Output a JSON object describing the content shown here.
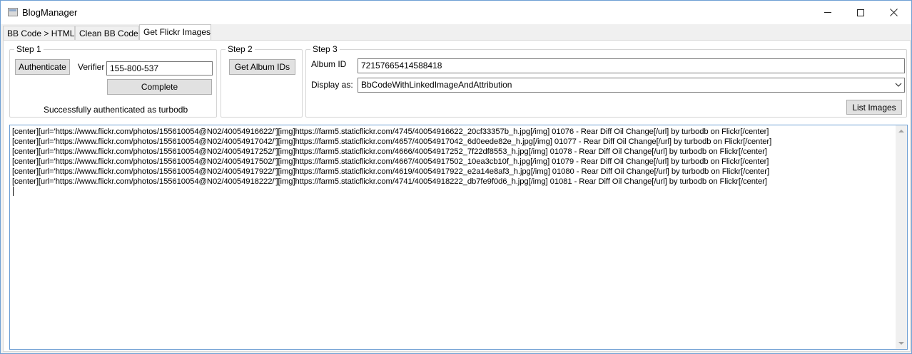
{
  "window": {
    "title": "BlogManager",
    "border_color": "#6e9fd4"
  },
  "title_controls": {
    "minimize_icon": "minimize-icon",
    "maximize_icon": "maximize-icon",
    "close_icon": "close-icon"
  },
  "tabs": [
    {
      "label": "BB Code > HTML",
      "active": false
    },
    {
      "label": "Clean BB Code",
      "active": false
    },
    {
      "label": "Get Flickr Images",
      "active": true
    }
  ],
  "step1": {
    "label": "Step 1",
    "authenticate_label": "Authenticate",
    "verifier_label": "Verifier",
    "verifier_value": "155-800-537",
    "complete_label": "Complete",
    "status_text": "Successfully authenticated as turbodb"
  },
  "step2": {
    "label": "Step 2",
    "get_album_ids_label": "Get Album IDs"
  },
  "step3": {
    "label": "Step 3",
    "album_id_label": "Album ID",
    "album_id_value": "72157665414588418",
    "display_as_label": "Display as:",
    "display_as_value": "BbCodeWithLinkedImageAndAttribution",
    "list_images_label": "List Images"
  },
  "output": {
    "lines": [
      "[center][url='https://www.flickr.com/photos/155610054@N02/40054916622/'][img]https://farm5.staticflickr.com/4745/40054916622_20cf33357b_h.jpg[/img] 01076 - Rear Diff Oil Change[/url] by turbodb on Flickr[/center]",
      "[center][url='https://www.flickr.com/photos/155610054@N02/40054917042/'][img]https://farm5.staticflickr.com/4657/40054917042_6d0eede82e_h.jpg[/img] 01077 - Rear Diff Oil Change[/url] by turbodb on Flickr[/center]",
      "[center][url='https://www.flickr.com/photos/155610054@N02/40054917252/'][img]https://farm5.staticflickr.com/4666/40054917252_7f22df8553_h.jpg[/img] 01078 - Rear Diff Oil Change[/url] by turbodb on Flickr[/center]",
      "[center][url='https://www.flickr.com/photos/155610054@N02/40054917502/'][img]https://farm5.staticflickr.com/4667/40054917502_10ea3cb10f_h.jpg[/img] 01079 - Rear Diff Oil Change[/url] by turbodb on Flickr[/center]",
      "[center][url='https://www.flickr.com/photos/155610054@N02/40054917922/'][img]https://farm5.staticflickr.com/4619/40054917922_e2a14e8af3_h.jpg[/img] 01080 - Rear Diff Oil Change[/url] by turbodb on Flickr[/center]",
      "[center][url='https://www.flickr.com/photos/155610054@N02/40054918222/'][img]https://farm5.staticflickr.com/4741/40054918222_db7fe9f0d6_h.jpg[/img] 01081 - Rear Diff Oil Change[/url] by turbodb on Flickr[/center]"
    ]
  }
}
